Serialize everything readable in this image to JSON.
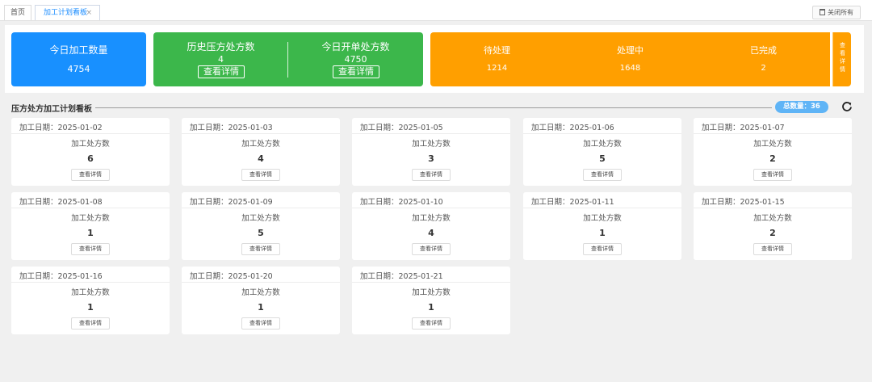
{
  "tabs": {
    "home": "首页",
    "active": "加工计划看板",
    "close": "×",
    "close_all": "关闭所有"
  },
  "summary": {
    "today": {
      "label": "今日加工数量",
      "value": "4754"
    },
    "history": {
      "label": "历史压方处方数",
      "value": "4",
      "detail": "查看详情"
    },
    "today_orders": {
      "label": "今日开单处方数",
      "value": "4750",
      "detail": "查看详情"
    },
    "pending": {
      "label": "待处理",
      "value": "1214"
    },
    "processing": {
      "label": "处理中",
      "value": "1648"
    },
    "done": {
      "label": "已完成",
      "value": "2"
    },
    "side_detail": "查看详情"
  },
  "board": {
    "title": "压方处方加工计划看板",
    "total": "总数量：36",
    "date_prefix": "加工日期：",
    "count_label": "加工处方数",
    "detail_label": "查看详情",
    "cards": [
      {
        "date": "加工日期：2025-01-02",
        "count": "6"
      },
      {
        "date": "加工日期：2025-01-03",
        "count": "4"
      },
      {
        "date": "加工日期：2025-01-05",
        "count": "3"
      },
      {
        "date": "加工日期：2025-01-06",
        "count": "5"
      },
      {
        "date": "加工日期：2025-01-07",
        "count": "2"
      },
      {
        "date": "加工日期：2025-01-08",
        "count": "1"
      },
      {
        "date": "加工日期：2025-01-09",
        "count": "5"
      },
      {
        "date": "加工日期：2025-01-10",
        "count": "4"
      },
      {
        "date": "加工日期：2025-01-11",
        "count": "1"
      },
      {
        "date": "加工日期：2025-01-15",
        "count": "2"
      },
      {
        "date": "加工日期：2025-01-16",
        "count": "1"
      },
      {
        "date": "加工日期：2025-01-20",
        "count": "1"
      },
      {
        "date": "加工日期：2025-01-21",
        "count": "1"
      }
    ]
  },
  "colors": {
    "blue": "#1890ff",
    "green": "#3cb74b",
    "orange": "#ff9f00",
    "pill": "#5fb4f6"
  }
}
